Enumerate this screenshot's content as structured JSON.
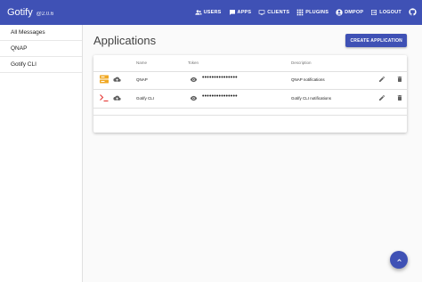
{
  "app": {
    "title": "Gotify",
    "version": "@2.0.6"
  },
  "nav": [
    {
      "label": "USERS",
      "icon": "users-icon"
    },
    {
      "label": "APPS",
      "icon": "apps-icon"
    },
    {
      "label": "CLIENTS",
      "icon": "clients-icon"
    },
    {
      "label": "PLUGINS",
      "icon": "plugins-icon"
    },
    {
      "label": "DMPOP",
      "icon": "account-icon"
    },
    {
      "label": "LOGOUT",
      "icon": "logout-icon"
    }
  ],
  "sidebar": {
    "items": [
      {
        "label": "All Messages"
      },
      {
        "label": "QNAP"
      },
      {
        "label": "Gotify CLI"
      }
    ]
  },
  "main": {
    "title": "Applications",
    "create_label": "CREATE APPLICATION",
    "columns": {
      "name": "Name",
      "token": "Token",
      "description": "Description"
    },
    "rows": [
      {
        "name": "QNAP",
        "token": "•••••••••••••••",
        "description": "QNAP notifications",
        "icon": "qnap-server-icon"
      },
      {
        "name": "Gotify CLI",
        "token": "•••••••••••••••",
        "description": "Gotify CLI notifications",
        "icon": "terminal-icon"
      }
    ]
  },
  "colors": {
    "primary": "#3f51b5",
    "qnap_icon": "#f0a824",
    "terminal_icon": "#e53935"
  }
}
